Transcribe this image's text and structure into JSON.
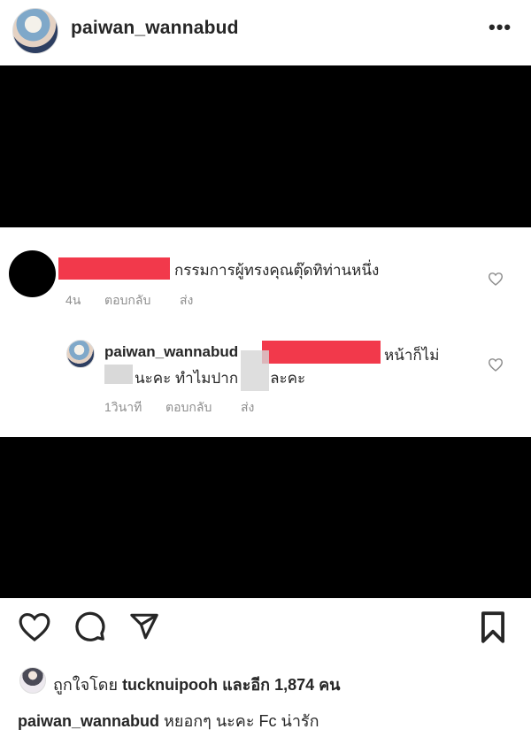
{
  "header": {
    "username": "paiwan_wannabud",
    "more_label": "•••"
  },
  "comment": {
    "text": "กรรมการผู้ทรงคุณตุ๊ดทิท่านหนึ่ง",
    "time": "4น",
    "reply_label": "ตอบกลับ",
    "send_label": "ส่ง"
  },
  "reply": {
    "username": "paiwan_wannabud",
    "text_line1": "หน้าก็ไม่",
    "text_line2": "นะคะ ทำไมปาก",
    "text_line2b": "ละคะ",
    "time": "1วินาที",
    "reply_label": "ตอบกลับ",
    "send_label": "ส่ง"
  },
  "likes": {
    "prefix": "ถูกใจโดย",
    "user": "tucknuipooh",
    "suffix": "และอีก 1,874 คน"
  },
  "caption": {
    "username": "paiwan_wannabud",
    "text": "หยอกๆ นะคะ Fc น่ารัก"
  },
  "icons": {
    "heart": "heart-icon",
    "comment": "comment-icon",
    "share": "share-icon",
    "save": "bookmark-icon"
  },
  "colors": {
    "redaction": "#f2394b",
    "muted_text": "#8e8e8e"
  }
}
